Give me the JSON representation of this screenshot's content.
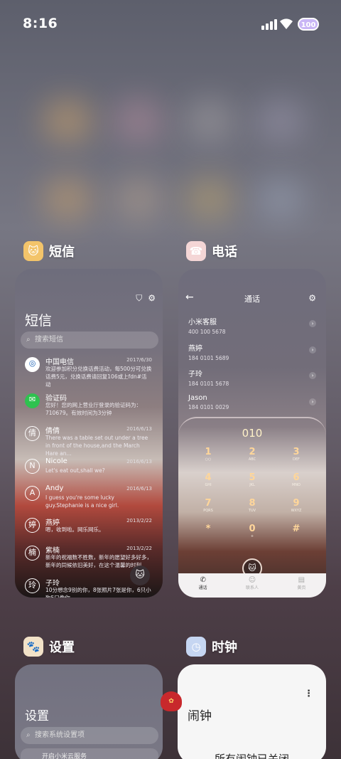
{
  "status": {
    "time": "8:16",
    "battery": "100"
  },
  "apps": {
    "sms": {
      "name": "短信",
      "icon": "cat-sms-icon"
    },
    "phone": {
      "name": "电话",
      "icon": "cat-phone-icon"
    },
    "settings": {
      "name": "设置",
      "icon": "cat-settings-icon"
    },
    "clock": {
      "name": "时钟",
      "icon": "cat-clock-icon"
    }
  },
  "sms": {
    "title": "短信",
    "search_placeholder": "搜索短信",
    "messages": [
      {
        "avatar": "",
        "name": "中国电信",
        "date": "2017/6/30",
        "body": "欢迎参加积分兑换话费活动，每500分可兑换话费5元，兑换话费请回复106或上fdn#活动"
      },
      {
        "avatar": "",
        "name": "验证码",
        "date": "",
        "body": "您好！您的网上营业厅登录的验证码为：710679。有效时间为3分钟"
      },
      {
        "avatar": "倩",
        "name": "倩倩",
        "date": "2016/6/13",
        "body": "There was a table set out under a tree in front of the house,and the March Hare an..."
      },
      {
        "avatar": "N",
        "name": "Nicole",
        "date": "2016/6/13",
        "body": "Let's eat out,shall we?"
      },
      {
        "avatar": "A",
        "name": "Andy",
        "date": "2016/6/13",
        "body": "I guess you're some lucky guy.Stephanie is a nice girl."
      },
      {
        "avatar": "婷",
        "name": "燕婷",
        "date": "2013/2/22",
        "body": "嗯，收到啦。网乐网乐。"
      },
      {
        "avatar": "楠",
        "name": "紫楠",
        "date": "2013/2/22",
        "body": "新年的祝福数不胜数，新年的愿望好多好多，新年的同候依旧美好，在这个温馨的时刻"
      },
      {
        "avatar": "玲",
        "name": "子玲",
        "date": "",
        "body": "10分想念9别的你，8张照片7张是你，6只小狗5只像你..."
      }
    ]
  },
  "phone": {
    "title": "通话",
    "contacts": [
      {
        "name": "小米客服",
        "number": "400 100 5678"
      },
      {
        "name": "燕婷",
        "number": "184 0101 5689"
      },
      {
        "name": "子玲",
        "number": "184 0101 5678"
      },
      {
        "name": "Jason",
        "number": "184 0101 0029"
      }
    ],
    "dialed": "010",
    "keys": [
      {
        "d": "1",
        "l": "○○"
      },
      {
        "d": "2",
        "l": "ABC"
      },
      {
        "d": "3",
        "l": "DEF"
      },
      {
        "d": "4",
        "l": "GHI"
      },
      {
        "d": "5",
        "l": "JKL"
      },
      {
        "d": "6",
        "l": "MNO"
      },
      {
        "d": "7",
        "l": "PQRS"
      },
      {
        "d": "8",
        "l": "TUV"
      },
      {
        "d": "9",
        "l": "WXYZ"
      },
      {
        "d": "*",
        "l": ""
      },
      {
        "d": "0",
        "l": "+"
      },
      {
        "d": "#",
        "l": ""
      }
    ],
    "tabs": [
      "通话",
      "联系人",
      "黄页"
    ]
  },
  "settings": {
    "title": "设置",
    "search_placeholder": "搜索系统设置项",
    "first_row": "开启小米云服务"
  },
  "clock": {
    "title": "闹钟",
    "message": "所有闹钟已关闭"
  },
  "colors": {
    "accent_red": "#c8282c",
    "dial_gold": "#ffd69a"
  }
}
